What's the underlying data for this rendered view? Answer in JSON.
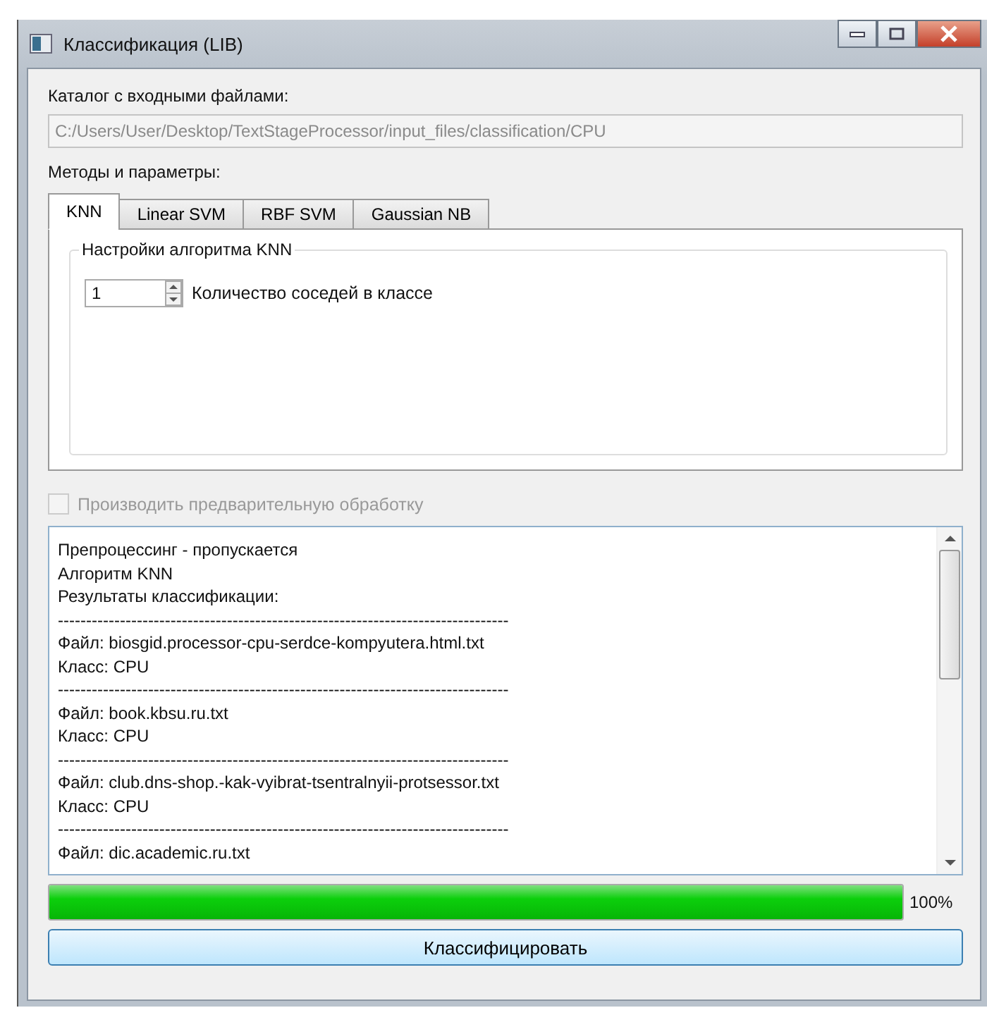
{
  "window": {
    "title": "Классификация (LIB)"
  },
  "input_dir": {
    "label": "Каталог с входными файлами:",
    "value": "C:/Users/User/Desktop/TextStageProcessor/input_files/classification/CPU",
    "disabled": true
  },
  "methods_label": "Методы и параметры:",
  "tabs": [
    {
      "label": "KNN",
      "selected": true
    },
    {
      "label": "Linear SVM",
      "selected": false
    },
    {
      "label": "RBF SVM",
      "selected": false
    },
    {
      "label": "Gaussian NB",
      "selected": false
    }
  ],
  "group": {
    "title": "Настройки алгоритма KNN",
    "spinbox": {
      "value": "1",
      "label": "Количество соседей в классе"
    }
  },
  "preprocess": {
    "label": "Производить предварительную обработку",
    "checked": false,
    "disabled": true
  },
  "log": [
    "Препроцессинг - пропускается",
    "Алгоритм KNN",
    "Результаты классификации:",
    "--------------------------------------------------------------------------------",
    "Файл: biosgid.processor-cpu-serdce-kompyutera.html.txt",
    "Класс: CPU",
    "--------------------------------------------------------------------------------",
    "Файл: book.kbsu.ru.txt",
    "Класс: CPU",
    "--------------------------------------------------------------------------------",
    "Файл: club.dns-shop.-kak-vyibrat-tsentralnyii-protsessor.txt",
    "Класс: CPU",
    "--------------------------------------------------------------------------------",
    "Файл: dic.academic.ru.txt"
  ],
  "progress": {
    "level": 1,
    "text": "100%"
  },
  "button": "Классифицировать"
}
